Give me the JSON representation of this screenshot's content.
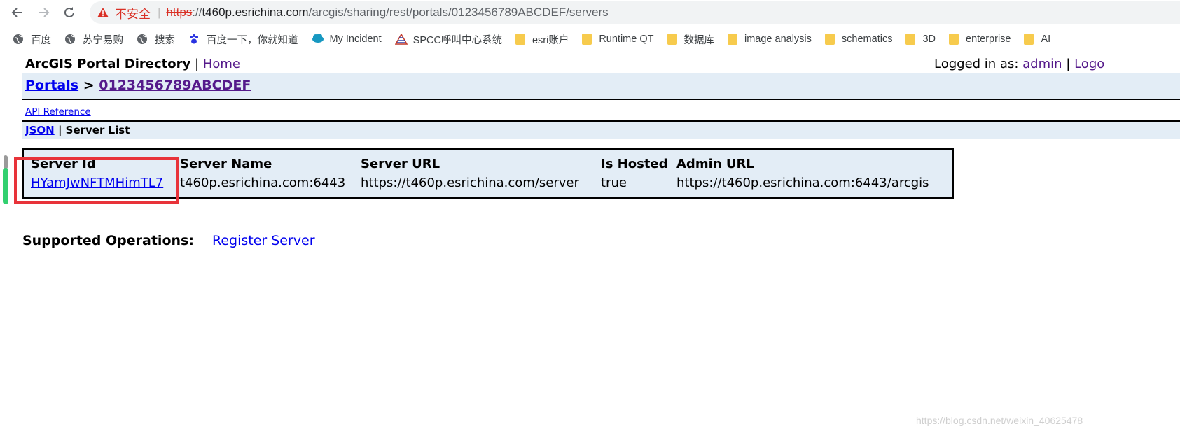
{
  "browser": {
    "address": {
      "warning": "不安全",
      "separator": "|",
      "scheme": "https",
      "host_prefix": "://",
      "host": "t460p.esrichina.com",
      "path": "/arcgis/sharing/rest/portals/0123456789ABCDEF/servers"
    },
    "bookmarks": [
      {
        "label": "百度",
        "icon": "globe-icon"
      },
      {
        "label": "苏宁易购",
        "icon": "globe-icon"
      },
      {
        "label": "搜索",
        "icon": "globe-icon"
      },
      {
        "label": "百度一下，你就知道",
        "icon": "baidu-paw-icon"
      },
      {
        "label": "My Incident",
        "icon": "salesforce-cloud-icon"
      },
      {
        "label": "SPCC呼叫中心系统",
        "icon": "spcc-logo-icon"
      },
      {
        "label": "esri账户",
        "icon": "folder-icon"
      },
      {
        "label": "Runtime QT",
        "icon": "folder-icon"
      },
      {
        "label": "数据库",
        "icon": "folder-icon"
      },
      {
        "label": "image analysis",
        "icon": "folder-icon"
      },
      {
        "label": "schematics",
        "icon": "folder-icon"
      },
      {
        "label": "3D",
        "icon": "folder-icon"
      },
      {
        "label": "enterprise",
        "icon": "folder-icon"
      },
      {
        "label": "AI",
        "icon": "folder-icon"
      }
    ]
  },
  "page": {
    "directory_title": "ArcGIS Portal Directory",
    "bar_sep": "|",
    "home_link": "Home",
    "logged_in_prefix": "Logged in as:",
    "user": "admin",
    "logout_partial": "Logo",
    "breadcrumb": {
      "portals": "Portals",
      "arrow": ">",
      "portal_id": "0123456789ABCDEF"
    },
    "api_reference": "API Reference",
    "json_link": "JSON",
    "section_title": "Server List",
    "table": {
      "headers": [
        "Server Id",
        "Server Name",
        "Server URL",
        "Is Hosted",
        "Admin URL"
      ],
      "rows": [
        [
          "HYamJwNFTMHimTL7",
          "t460p.esrichina.com:6443",
          "https://t460p.esrichina.com/server",
          "true",
          "https://t460p.esrichina.com:6443/arcgis"
        ]
      ]
    },
    "supported_operations_label": "Supported Operations:",
    "register_server": "Register Server",
    "watermark": "https://blog.csdn.net/weixin_40625478"
  },
  "colors": {
    "highlight": "#e8333a",
    "panel": "#e3edf6",
    "link": "#0000ee",
    "visited": "#551a8b"
  }
}
